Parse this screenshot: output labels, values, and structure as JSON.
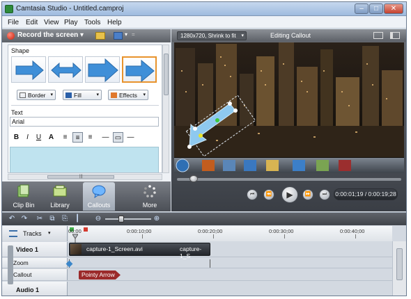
{
  "window": {
    "title": "Camtasia Studio - Untitled.camproj"
  },
  "titlebar_buttons": {
    "minimize": "–",
    "maximize": "□",
    "close": "✕"
  },
  "menu": [
    "File",
    "Edit",
    "View",
    "Play",
    "Tools",
    "Help"
  ],
  "toolbar": {
    "record_label": "Record the screen",
    "record_arrow": "▾",
    "produce_arrow": "▾",
    "customize_arrow": "="
  },
  "callout_panel": {
    "shape_label": "Shape",
    "shapes": [
      "arrow-right",
      "double-arrow",
      "arrow-right-bold",
      "arrow-right-selected"
    ],
    "border_label": "Border",
    "fill_label": "Fill",
    "effects_label": "Effects",
    "dropdown_arrow": "▾",
    "text_label": "Text",
    "font": "Arial",
    "format_buttons": [
      "B",
      "I",
      "U",
      "A",
      "≡",
      "≡",
      "≡",
      "—",
      "▭",
      "—"
    ]
  },
  "hscroll_grip": "|||",
  "tabs": [
    {
      "label": "Clip Bin",
      "icon": "clip-bin-icon"
    },
    {
      "label": "Library",
      "icon": "library-icon"
    },
    {
      "label": "Callouts",
      "icon": "callouts-icon"
    },
    {
      "label": "More",
      "icon": "more-icon"
    }
  ],
  "preview": {
    "resolution": "1280x720, Shrink to fit",
    "resolution_arrow": "▾",
    "mode_label": "Editing Callout",
    "time": "0:00:01;19 / 0:00:19;28"
  },
  "player_controls": {
    "prev": "⏮",
    "rewind": "⏪",
    "play": "▶",
    "forward": "⏩",
    "next": "⏭"
  },
  "timeline": {
    "tracks_label": "Tracks",
    "tracks_arrow": "▾",
    "tools": [
      "↶",
      "↷",
      "✂",
      "⧉",
      "⎘",
      "┃",
      "⊖",
      "⊕"
    ],
    "ruler": [
      "00:00",
      "0:00:10;00",
      "0:00:20;00",
      "0:00:30;00",
      "0:00:40;00"
    ],
    "video_track": "Video 1",
    "zoom_track": "Zoom",
    "callout_track": "Callout",
    "audio_track": "Audio 1",
    "clip_name": "capture-1_Screen.avi",
    "clip_name_2": "capture-1_S",
    "callout_clip": "Pointy Arrow"
  },
  "colors": {
    "accent": "#e8932c",
    "record": "#c81e0a",
    "callout_clip": "#9b2a2a",
    "callout_fill": "#bfe3ef"
  }
}
